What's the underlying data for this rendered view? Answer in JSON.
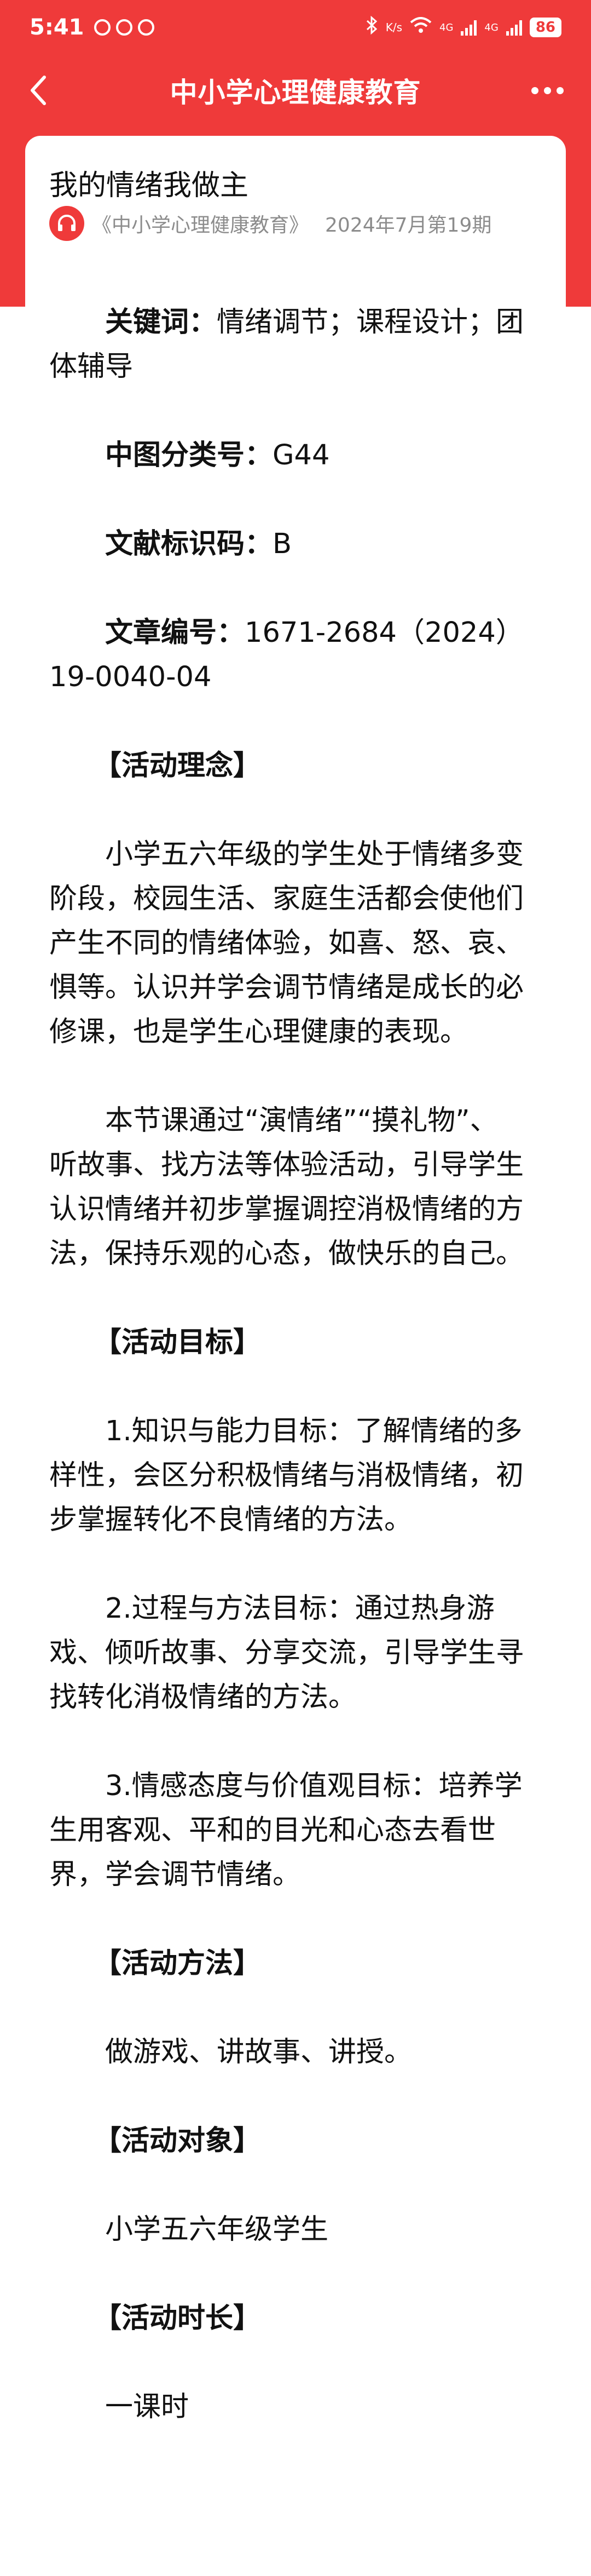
{
  "status_bar": {
    "time": "5:41",
    "network_speed": "K/s",
    "signal_labels": [
      "4G",
      "4G"
    ],
    "battery": "86"
  },
  "nav": {
    "title": "中小学心理健康教育"
  },
  "article": {
    "title": "我的情绪我做主",
    "source": "《中小学心理健康教育》",
    "issue": "2024年7月第19期",
    "meta": [
      {
        "label": "关键词：",
        "value": "情绪调节；课程设计；团体辅导"
      },
      {
        "label": "中图分类号：",
        "value": "G44"
      },
      {
        "label": "文献标识码：",
        "value": "B"
      },
      {
        "label": "文章编号：",
        "value": "1671-2684（2024）19-0040-04"
      }
    ],
    "sections": [
      {
        "heading": "【活动理念】",
        "paragraphs": [
          "小学五六年级的学生处于情绪多变阶段，校园生活、家庭生活都会使他们产生不同的情绪体验，如喜、怒、哀、惧等。认识并学会调节情绪是成长的必修课，也是学生心理健康的表现。",
          "本节课通过“演情绪”“摸礼物”、听故事、找方法等体验活动，引导学生认识情绪并初步掌握调控消极情绪的方法，保持乐观的心态，做快乐的自己。"
        ]
      },
      {
        "heading": "【活动目标】",
        "paragraphs": [
          "1.知识与能力目标：了解情绪的多样性，会区分积极情绪与消极情绪，初步掌握转化不良情绪的方法。",
          "2.过程与方法目标：通过热身游戏、倾听故事、分享交流，引导学生寻找转化消极情绪的方法。",
          "3.情感态度与价值观目标：培养学生用客观、平和的目光和心态去看世界，学会调节情绪。"
        ]
      },
      {
        "heading": "【活动方法】",
        "paragraphs": [
          "做游戏、讲故事、讲授。"
        ]
      },
      {
        "heading": "【活动对象】",
        "paragraphs": [
          "小学五六年级学生"
        ]
      },
      {
        "heading": "【活动时长】",
        "paragraphs": [
          "一课时"
        ]
      }
    ]
  },
  "colors": {
    "brand_red": "#ef3a3a",
    "text": "#111111",
    "muted": "#8c8c8c"
  },
  "icons": {
    "back": "chevron-left-icon",
    "more": "more-dots-icon",
    "source": "headphone-icon"
  }
}
